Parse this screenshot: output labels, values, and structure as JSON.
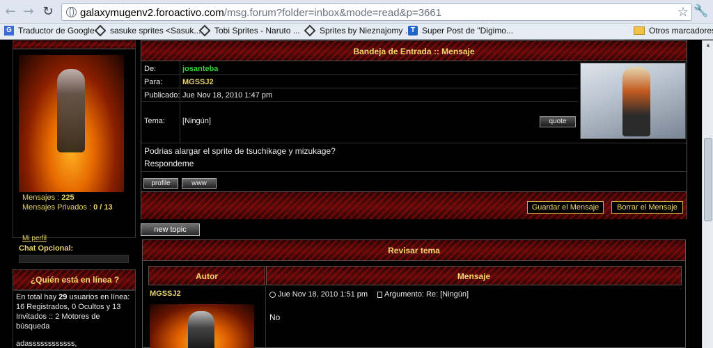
{
  "browser": {
    "url_domain": "galaxymugenv2.foroactivo.com",
    "url_path": "/msg.forum?folder=inbox&mode=read&p=3661",
    "bookmarks": [
      {
        "label": "Traductor de Google",
        "icon": "google-translate-icon"
      },
      {
        "label": "sasuke sprites <Sasuk...",
        "icon": "diamond-icon"
      },
      {
        "label": "Tobi Sprites - Naruto ...",
        "icon": "diamond-icon"
      },
      {
        "label": "Sprites by Nieznajomy ...",
        "icon": "diamond-icon"
      },
      {
        "label": "Super Post de \"Digimo...",
        "icon": "taringa-icon"
      }
    ],
    "other_bookmarks": "Otros marcadores"
  },
  "sidebar": {
    "messages_label": "Mensajes : ",
    "messages_value": "225",
    "private_label": "Mensajes Privados : ",
    "private_value": "0 / 13",
    "my_profile": "Mi perfil",
    "chat_label": "Chat Opcional:",
    "online_title": "¿Quién está en línea ?",
    "online_prefix": "En total hay ",
    "online_count": "29",
    "online_suffix": " usuarios en línea: 16 Registrados, 0 Ocultos y 13 Invitados :: 2 Motores de búsqueda",
    "online_users": "adassssssssssss,"
  },
  "message": {
    "title": "Bandeja de Entrada :: Mensaje",
    "from_label": "De:",
    "from_value": "josanteba",
    "to_label": "Para:",
    "to_value": "MGSSJ2",
    "posted_label": "Publicado:",
    "posted_value": "Jue Nov 18, 2010 1:47 pm",
    "subject_label": "Tema:",
    "subject_value": "[Ningún]",
    "quote_button": "quote",
    "body_line1": "Podrias alargar el sprite de tsuchikage y mizukage?",
    "body_line2": "Respondeme",
    "profile_button": "profile",
    "www_button": "www",
    "save_button": "Guardar el Mensaje",
    "delete_button": "Borrar el Mensaje"
  },
  "new_topic_button": "new topic",
  "review": {
    "title": "Revisar tema",
    "col_author": "Autor",
    "col_message": "Mensaje",
    "post_author": "MGSSJ2",
    "post_date": "Jue Nov 18, 2010 1:51 pm",
    "post_subject": "Argumento: Re: [Ningún]",
    "post_body": "No"
  },
  "colors": {
    "accent_gold": "#f2d86a",
    "sender_green": "#35d13a",
    "background": "#000000",
    "header_red": "#5a0b0b"
  }
}
